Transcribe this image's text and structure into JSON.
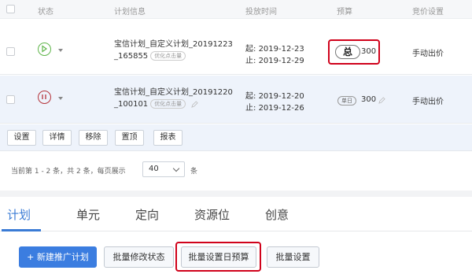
{
  "header": {
    "status": "状态",
    "plan_info": "计划信息",
    "schedule": "投放时间",
    "budget": "预算",
    "bidding": "竞价设置"
  },
  "rows": [
    {
      "status": "running",
      "status_color": "#5fb54a",
      "name_line1": "宝信计划_自定义计划_20191223",
      "name_line2": "_165855",
      "tag": "优化点击量",
      "start_label": "起:",
      "start": "2019-12-23",
      "end_label": "止:",
      "end": "2019-12-29",
      "budget_badge": "总",
      "budget": "300",
      "bid": "手动出价"
    },
    {
      "status": "paused",
      "status_color": "#b5343b",
      "name_line1": "宝信计划_自定义计划_20191220",
      "name_line2": "_100101",
      "tag": "优化点击量",
      "start_label": "起:",
      "start": "2019-12-20",
      "end_label": "止:",
      "end": "2019-12-26",
      "budget_badge": "单日",
      "budget": "300",
      "bid": "手动出价"
    }
  ],
  "actions": {
    "settings": "设置",
    "details": "详情",
    "remove": "移除",
    "pin": "置顶",
    "report": "报表"
  },
  "pager": {
    "summary": "当前第 1 - 2 条，共 2 条，每页展示",
    "page_size": "40",
    "unit": "条"
  },
  "tabs": {
    "plan": "计划",
    "unit": "单元",
    "targeting": "定向",
    "placement": "资源位",
    "creative": "创意"
  },
  "bottom": {
    "new_plan": "+ 新建推广计划",
    "batch_status": "批量修改状态",
    "batch_daily_budget": "批量设置日预算",
    "batch_settings": "批量设置"
  },
  "colors": {
    "accent": "#3b7de0",
    "highlight": "#d0021b"
  }
}
